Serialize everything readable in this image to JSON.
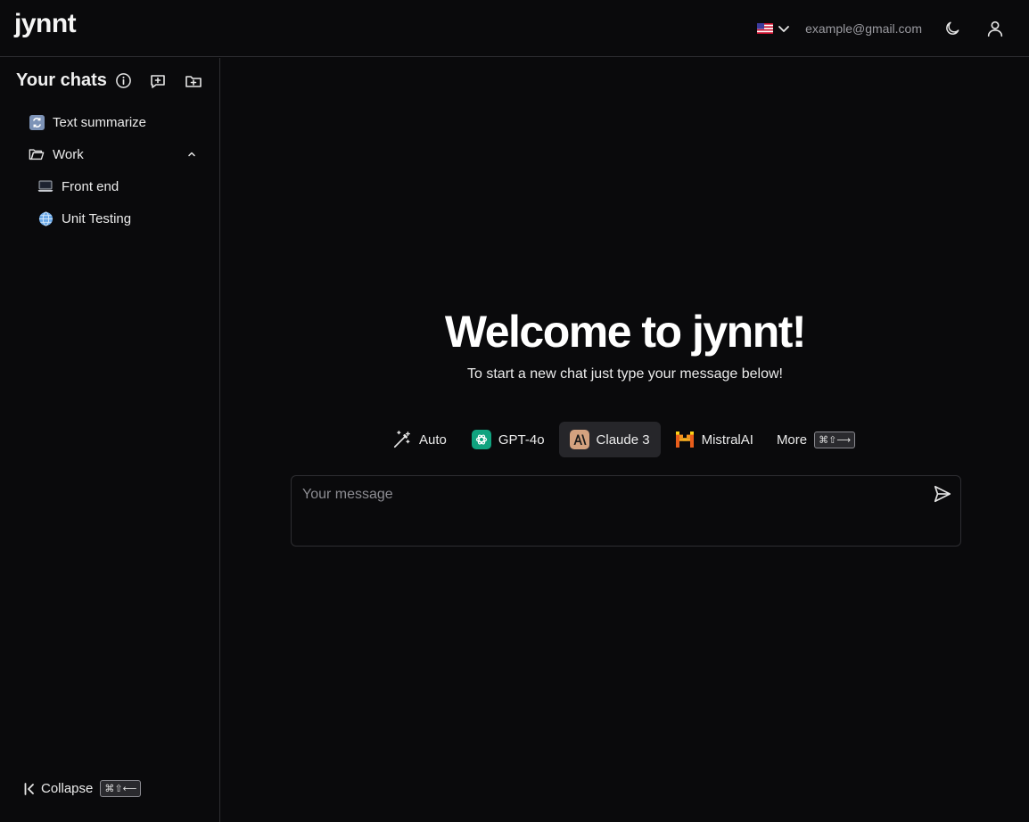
{
  "app": {
    "logo": "jynnt"
  },
  "topbar": {
    "email": "example@gmail.com"
  },
  "sidebar": {
    "title": "Your chats",
    "items": [
      {
        "label": "Text summarize",
        "icon": "arrows-emoji"
      },
      {
        "label": "Work",
        "icon": "folder-icon",
        "expanded": true
      },
      {
        "label": "Front end",
        "icon": "laptop-emoji"
      },
      {
        "label": "Unit Testing",
        "icon": "globe-emoji"
      }
    ],
    "collapse_label": "Collapse",
    "collapse_shortcut": "⌘⇧⟵"
  },
  "main": {
    "welcome": "Welcome to jynnt!",
    "subtitle": "To start a new chat just type your message below!",
    "models": [
      {
        "label": "Auto",
        "icon": "magic-wand-icon"
      },
      {
        "label": "GPT-4o",
        "icon": "openai-icon",
        "color": "#10a37f"
      },
      {
        "label": "Claude 3",
        "icon": "anthropic-icon",
        "color": "#d4a27f",
        "active": true
      },
      {
        "label": "MistralAI",
        "icon": "mistral-icon",
        "color": "#f7931e"
      },
      {
        "label": "More",
        "shortcut": "⌘⇧⟶"
      }
    ],
    "message_placeholder": "Your message"
  },
  "colors": {
    "background": "#0a0a0c",
    "border": "#2e2e32",
    "active_model_bg": "#26262a"
  }
}
